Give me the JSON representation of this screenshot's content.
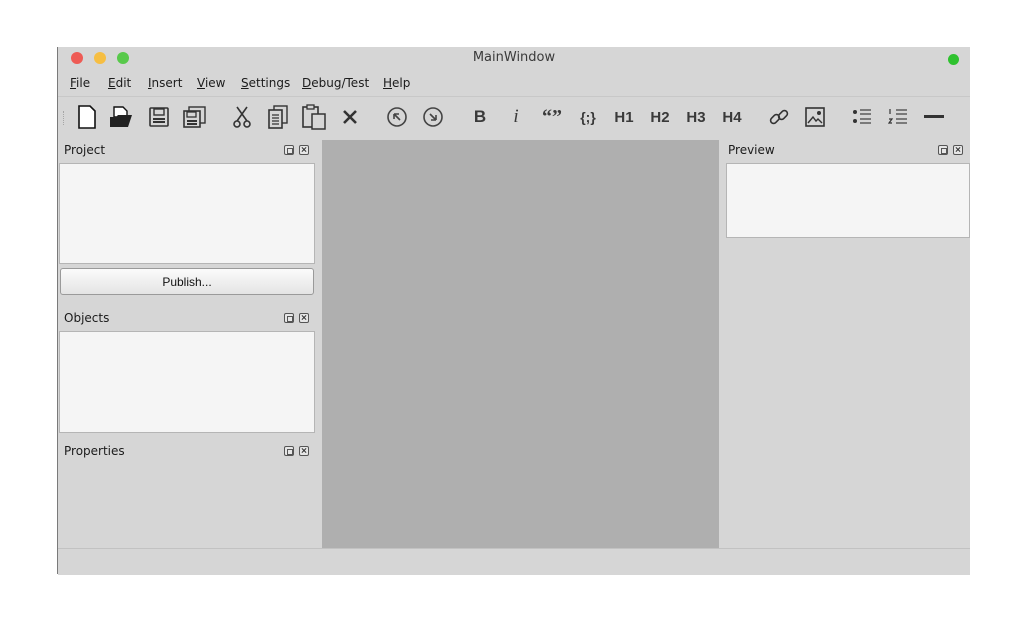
{
  "window": {
    "title": "MainWindow"
  },
  "menu": {
    "file": "File",
    "edit": "Edit",
    "insert": "Insert",
    "view": "View",
    "settings": "Settings",
    "debug": "Debug/Test",
    "help": "Help"
  },
  "toolbar": {
    "bold": "B",
    "italic": "i",
    "quote": "“”",
    "code": "{;}",
    "h1": "H1",
    "h2": "H2",
    "h3": "H3",
    "h4": "H4"
  },
  "docks": {
    "project": "Project",
    "publish_button": "Publish...",
    "objects": "Objects",
    "properties": "Properties",
    "preview": "Preview"
  },
  "colors": {
    "editor_bg": "#afafaf",
    "window_bg": "#d6d6d6",
    "status_light": "#2fc22f"
  }
}
